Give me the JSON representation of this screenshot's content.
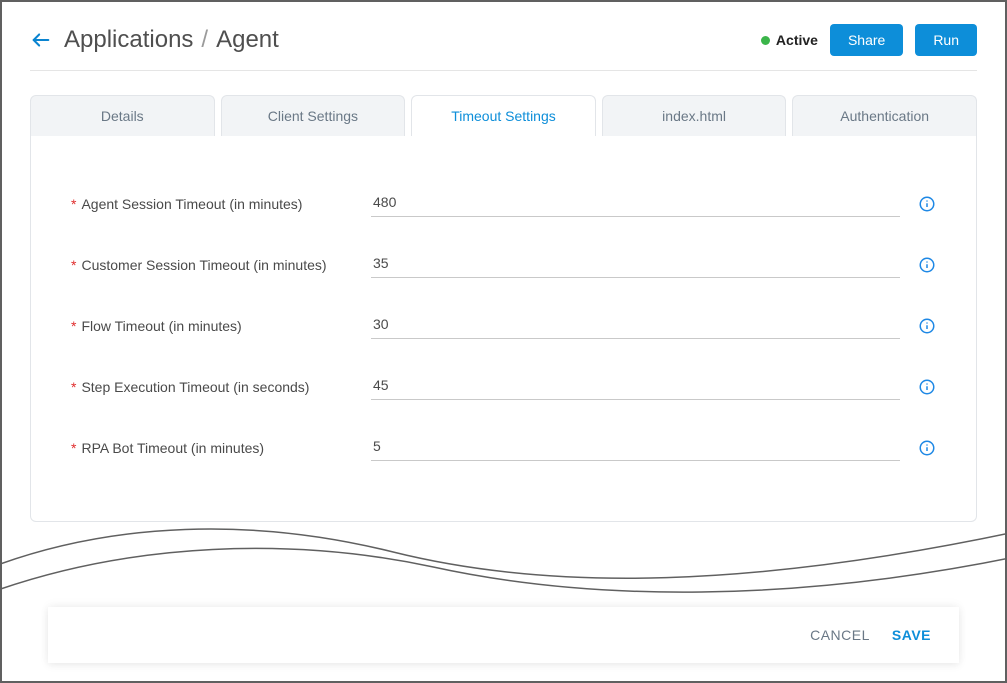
{
  "header": {
    "breadcrumb_root": "Applications",
    "breadcrumb_sep": "/",
    "breadcrumb_current": "Agent",
    "status_label": "Active",
    "share_label": "Share",
    "run_label": "Run"
  },
  "tabs": {
    "details": "Details",
    "client_settings": "Client Settings",
    "timeout_settings": "Timeout Settings",
    "index_html": "index.html",
    "authentication": "Authentication"
  },
  "fields": {
    "agent_session": {
      "label": "Agent Session Timeout (in minutes)",
      "value": "480"
    },
    "customer_session": {
      "label": "Customer Session Timeout (in minutes)",
      "value": "35"
    },
    "flow_timeout": {
      "label": "Flow Timeout (in minutes)",
      "value": "30"
    },
    "step_exec": {
      "label": "Step Execution Timeout (in seconds)",
      "value": "45"
    },
    "rpa_bot": {
      "label": "RPA Bot Timeout (in minutes)",
      "value": "5"
    }
  },
  "footer": {
    "cancel": "CANCEL",
    "save": "SAVE"
  }
}
